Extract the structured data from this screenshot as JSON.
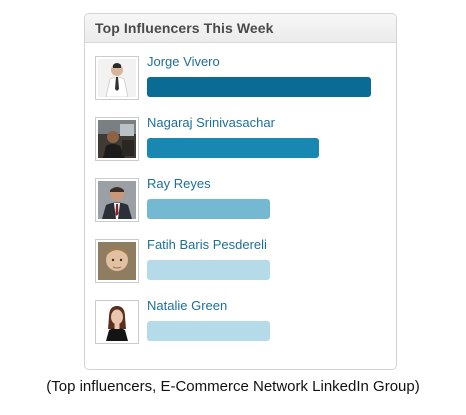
{
  "panel": {
    "title": "Top Influencers This Week"
  },
  "influencers": [
    {
      "name": "Jorge Vivero",
      "score_fraction": 1.0,
      "bar_color": "#0a6c95",
      "avatar_icon": "person-avatar-icon"
    },
    {
      "name": "Nagaraj Srinivasachar",
      "score_fraction": 0.77,
      "bar_color": "#1887b1",
      "avatar_icon": "person-avatar-icon"
    },
    {
      "name": "Ray Reyes",
      "score_fraction": 0.55,
      "bar_color": "#74b8d2",
      "avatar_icon": "person-avatar-icon"
    },
    {
      "name": "Fatih Baris Pesdereli",
      "score_fraction": 0.55,
      "bar_color": "#b6dbe8",
      "avatar_icon": "person-avatar-icon"
    },
    {
      "name": "Natalie Green",
      "score_fraction": 0.55,
      "bar_color": "#b6dbe8",
      "avatar_icon": "person-avatar-icon"
    }
  ],
  "caption": "(Top influencers, E-Commerce Network LinkedIn Group)"
}
